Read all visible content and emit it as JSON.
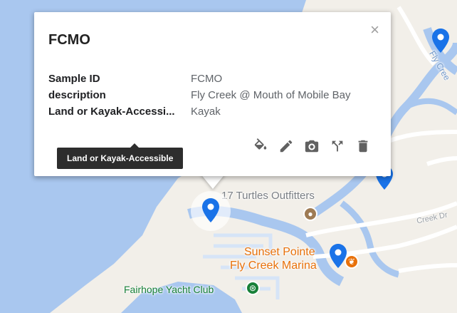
{
  "info_window": {
    "title": "FCMO",
    "fields": [
      {
        "key": "Sample ID",
        "value": "FCMO"
      },
      {
        "key": "description",
        "value": "Fly Creek @ Mouth of Mobile Bay"
      },
      {
        "key": "Land or Kayak-Accessi...",
        "value": "Kayak"
      }
    ],
    "tooltip": "Land or Kayak-Accessible",
    "close_symbol": "×",
    "toolbar_icons": [
      "paint-bucket-icon",
      "pencil-icon",
      "camera-icon",
      "directions-fork-icon",
      "trash-icon"
    ]
  },
  "map_labels": {
    "turtles": "17 Turtles Outfitters",
    "sunset_line1": "Sunset Pointe",
    "sunset_line2": "Fly Creek Marina",
    "yacht_club": "Fairhope Yacht Club",
    "creek_dr": "Creek Dr",
    "fly_creek": "Fly Cree"
  },
  "colors": {
    "water": "#a9c7ef",
    "land": "#f2efe9",
    "marker": "#1a73e8",
    "poi_orange": "#e8710a",
    "poi_green": "#188038"
  }
}
